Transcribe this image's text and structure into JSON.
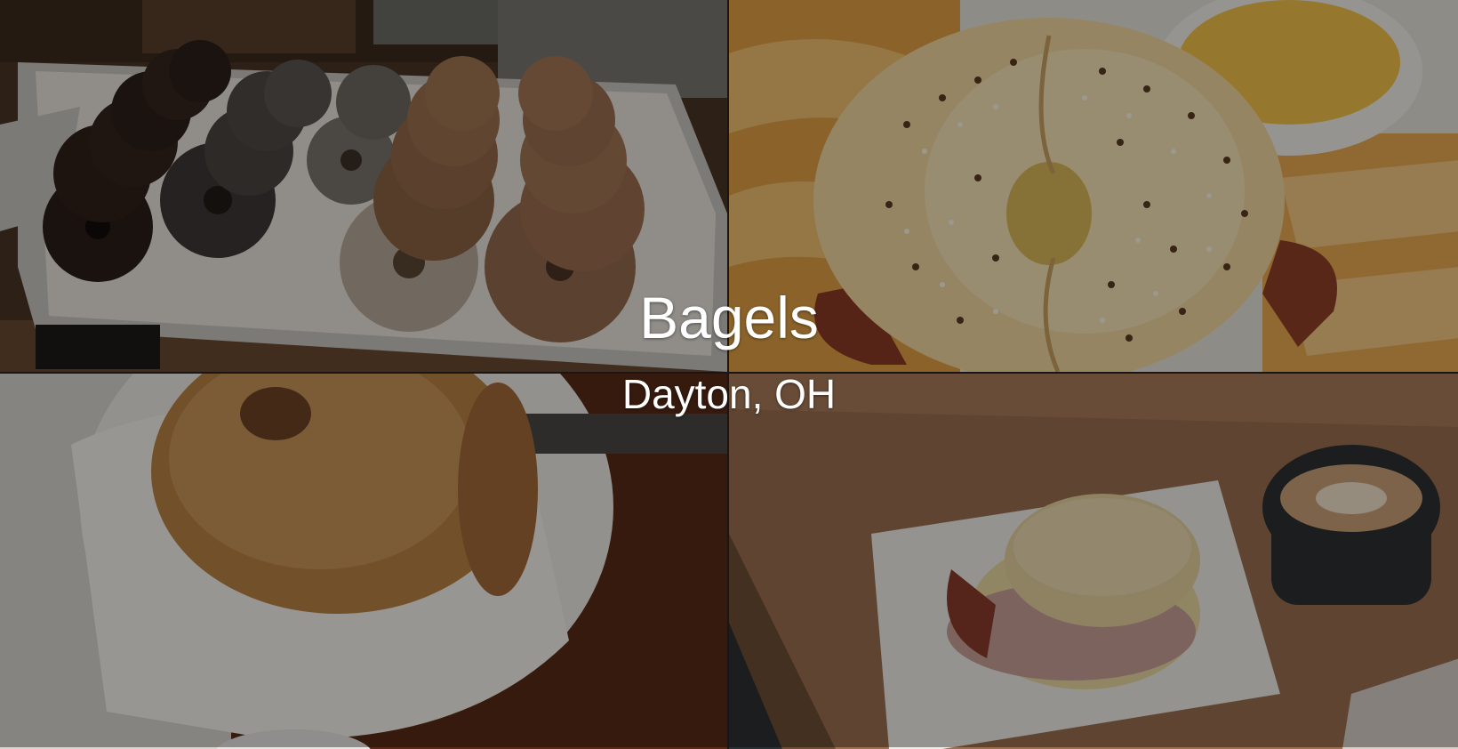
{
  "hero": {
    "title": "Bagels",
    "subtitle": "Dayton, OH"
  },
  "photos": [
    {
      "subject": "bagel-tray"
    },
    {
      "subject": "everything-bagel-sandwich"
    },
    {
      "subject": "toasted-bagel-in-basket"
    },
    {
      "subject": "breakfast-sandwich-and-coffee"
    }
  ],
  "colors": {
    "overlay": "#000000",
    "text": "#ffffff"
  }
}
